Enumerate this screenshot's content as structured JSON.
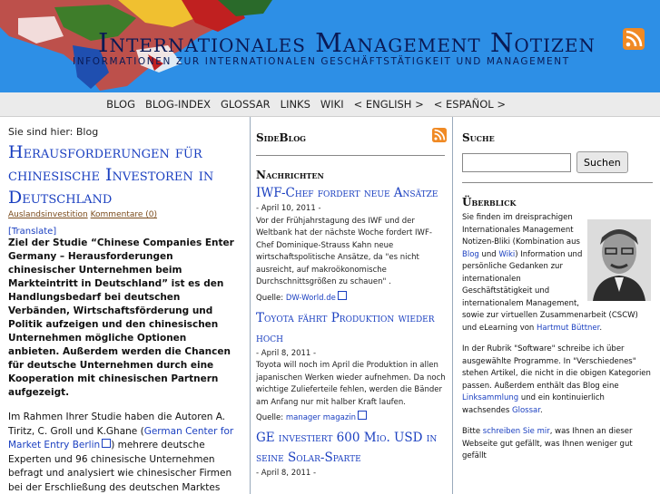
{
  "header": {
    "title": "Internationales Management Notizen",
    "subtitle": "INFORMATIONEN ZUR INTERNATIONALEN GESCHÄFTSTÄTIGKEIT UND MANAGEMENT"
  },
  "nav": [
    "BLOG",
    "BLOG-INDEX",
    "GLOSSAR",
    "LINKS",
    "WIKI",
    "< ENGLISH >",
    "< ESPAÑOL >"
  ],
  "main": {
    "breadcrumb": "Sie sind hier: Blog",
    "title": "Herausforderungen für chinesische Investoren in Deutschland",
    "cat": "Auslandsinvestition",
    "comments": "Kommentare (0)",
    "translate": "[Translate]",
    "intro": "Ziel der Studie “Chinese Companies Enter Germany – Herausforderungen chinesischer Unternehmen beim Markteintritt in Deutschland” ist es den Handlungsbedarf bei deutschen Verbänden, Wirtschaftsförderung und Politik aufzeigen und den chinesischen Unternehmen mögliche Optionen anbieten. Außerdem werden die Chancen für deutsche Unternehmen durch eine Kooperation mit chinesischen Partnern aufgezeigt.",
    "p_pre": "Im Rahmen Ihrer Studie haben die Autoren A. Tiritz, C. Groll und K.Ghane (",
    "p_link": "German Center for Market Entry Berlin",
    "p_post": ") mehrere deutsche Experten und 96 chinesische Unternehmen befragt und analysiert wie chinesischer Firmen bei der Erschließung des deutschen Marktes vorgehen."
  },
  "sideblog": {
    "heading": "SideBlog",
    "news_heading": "Nachrichten",
    "items": [
      {
        "title": "IWF-Chef fordert neue Ansätze",
        "date": "- April 10, 2011 -",
        "text": "Vor der Frühjahrstagung des IWF und der Weltbank hat der nächste Woche fordert IWF-Chef Dominique-Strauss Kahn neue wirtschaftspolitische Ansätze, da \"es nicht ausreicht, auf makroökonomische Durchschnittsgrößen zu schauen\" .",
        "source_label": "Quelle:",
        "source": "DW-World.de"
      },
      {
        "title": "Toyota fährt Produktion wieder hoch",
        "date": "- April 8, 2011 -",
        "text": "Toyota will noch im April die Produktion in allen japanischen Werken wieder aufnehmen. Da noch wichtige Zulieferteile fehlen, werden die Bänder am Anfang nur mit halber Kraft laufen.",
        "source_label": "Quelle:",
        "source": "manager magazin"
      },
      {
        "title": "GE investiert 600 Mio. USD in seine Solar-Sparte",
        "date": "- April 8, 2011 -",
        "text": "",
        "source_label": "",
        "source": ""
      }
    ]
  },
  "search": {
    "heading": "Suche",
    "button": "Suchen",
    "value": ""
  },
  "overview": {
    "heading": "Überblick",
    "p1_a": "Sie finden im dreisprachigen Internationales Management Notizen-Bliki (Kombination aus ",
    "blog": "Blog",
    "p1_b": " und ",
    "wiki": "Wiki",
    "p1_c": ") Information und persönliche Gedanken zur internationalen Geschäftstätigkeit und internationalem Management, sowie zur virtuellen Zusammenarbeit (CSCW) und eLearning von ",
    "author": "Hartmut Büttner",
    "p1_d": ".",
    "p2_a": "In der Rubrik \"Software\" schreibe ich über ausgewählte Programme. In \"Verschiedenes\" stehen Artikel, die nicht in die obigen Kategorien passen. Außerdem enthält das Blog eine ",
    "links": "Linksammlung",
    "p2_b": " und ein kontinuierlich wachsendes ",
    "glossar": "Glossar",
    "p2_c": ".",
    "p3_a": "Bitte ",
    "write": "schreiben Sie mir",
    "p3_b": ", was Ihnen an dieser Webseite gut gefällt, was Ihnen weniger gut gefällt"
  },
  "colors": {
    "header_bg": "#2d8fe6",
    "link": "#1a3fc0",
    "title_dark": "#0a1a55"
  },
  "icons": [
    "rss-icon",
    "external-link-icon",
    "world-map",
    "author-photo"
  ]
}
